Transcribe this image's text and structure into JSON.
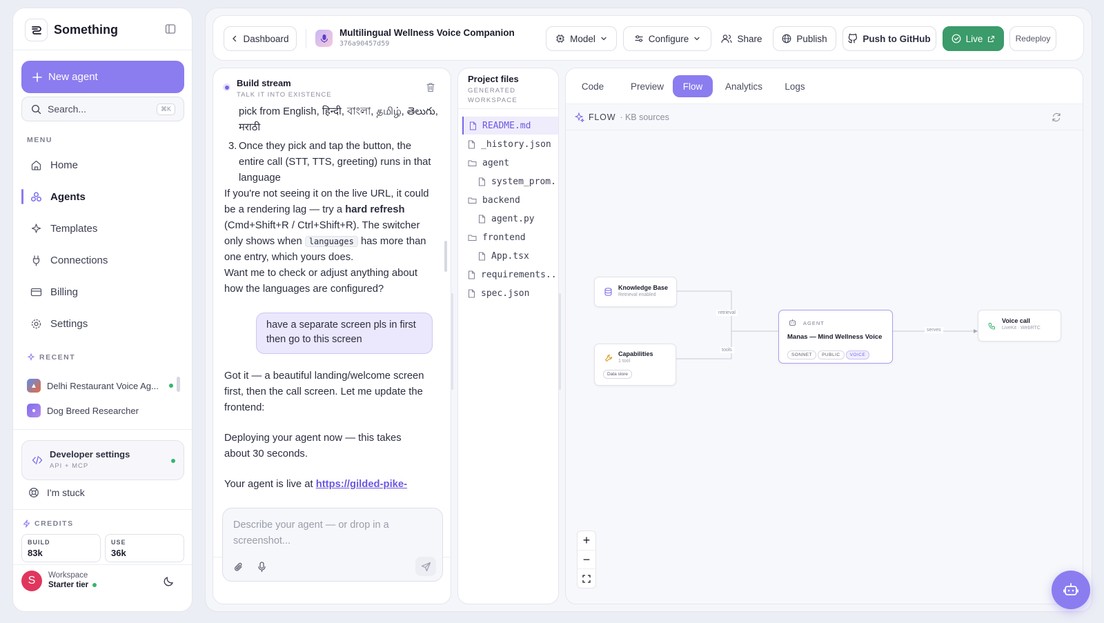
{
  "app": {
    "name": "Something"
  },
  "sidebar": {
    "new_agent": "New agent",
    "search_placeholder": "Search...",
    "search_shortcut": "⌘K",
    "menu_label": "MENU",
    "items": [
      {
        "label": "Home",
        "icon": "home-icon"
      },
      {
        "label": "Agents",
        "icon": "agents-icon",
        "active": true
      },
      {
        "label": "Templates",
        "icon": "sparkle-icon"
      },
      {
        "label": "Connections",
        "icon": "plug-icon"
      },
      {
        "label": "Billing",
        "icon": "card-icon"
      },
      {
        "label": "Settings",
        "icon": "gear-icon"
      }
    ],
    "recent_label": "RECENT",
    "recent": [
      {
        "label": "Delhi Restaurant Voice Ag...",
        "live": true
      },
      {
        "label": "Dog Breed Researcher",
        "live": false
      }
    ],
    "developer": {
      "title": "Developer settings",
      "subtitle": "API + MCP"
    },
    "stuck": "I'm stuck",
    "credits_label": "CREDITS",
    "credits": [
      {
        "label": "BUILD",
        "value": "83k"
      },
      {
        "label": "USE",
        "value": "36k"
      }
    ],
    "workspace": {
      "initial": "S",
      "label": "Workspace",
      "tier": "Starter tier"
    }
  },
  "topbar": {
    "back": "Dashboard",
    "project_title": "Multilingual Wellness Voice Companion",
    "project_id": "376a90457d59",
    "model": "Model",
    "configure": "Configure",
    "share": "Share",
    "publish": "Publish",
    "github": "Push to GitHub",
    "live": "Live",
    "redeploy": "Redeploy",
    "accent": "#3b9b6a"
  },
  "chat": {
    "title": "Build stream",
    "subtitle": "TALK IT INTO EXISTENCE",
    "line_top": "pick from English, हिन्दी, বাংলা, தமிழ், తెలుగు,",
    "line_top2": "मराठी",
    "item3": "Once they pick and tap the button, the entire call (STT, TTS, greeting) runs in that language",
    "p1_a": "If you're not seeing it on the live URL, it could be a rendering lag — try a ",
    "p1_bold": "hard refresh",
    "p1_b": " (Cmd+Shift+R / Ctrl+Shift+R). The switcher only shows when ",
    "p1_code": "languages",
    "p1_c": " has more than one entry, which yours does.",
    "p2": "Want me to check or adjust anything about how the languages are configured?",
    "user_msg": "have a separate screen pls in first then go to this screen",
    "p3": "Got it — a beautiful landing/welcome screen first, then the call screen. Let me update the frontend:",
    "p4": "Deploying your agent now — this takes about 30 seconds.",
    "p5_a": "Your agent is live at ",
    "p5_link": "https://gilded-pike-",
    "input_placeholder": "Describe your agent — or drop in a screenshot..."
  },
  "files": {
    "title": "Project files",
    "subtitle": "GENERATED WORKSPACE",
    "items": [
      {
        "name": "README.md",
        "type": "file",
        "depth": 0,
        "selected": true
      },
      {
        "name": "_history.json",
        "type": "file",
        "depth": 0
      },
      {
        "name": "agent",
        "type": "folder",
        "depth": 0
      },
      {
        "name": "system_prom...",
        "type": "file",
        "depth": 1
      },
      {
        "name": "backend",
        "type": "folder",
        "depth": 0
      },
      {
        "name": "agent.py",
        "type": "file",
        "depth": 1
      },
      {
        "name": "frontend",
        "type": "folder",
        "depth": 0
      },
      {
        "name": "App.tsx",
        "type": "file",
        "depth": 1
      },
      {
        "name": "requirements....",
        "type": "file",
        "depth": 0
      },
      {
        "name": "spec.json",
        "type": "file",
        "depth": 0
      }
    ]
  },
  "workspace": {
    "tabs": [
      "Code",
      "Preview",
      "Flow",
      "Analytics",
      "Logs"
    ],
    "active_tab": "Flow",
    "flow_label": "FLOW",
    "flow_sub": "· KB sources",
    "nodes": {
      "kb": {
        "title": "Knowledge Base",
        "sub": "Retrieval enabled"
      },
      "cap": {
        "title": "Capabilities",
        "sub": "1 tool",
        "chip": "Data store"
      },
      "agent": {
        "kicker": "AGENT",
        "title": "Manas — Mind Wellness Voice",
        "chips": [
          "SONNET",
          "PUBLIC",
          "VOICE"
        ]
      },
      "voice": {
        "title": "Voice call",
        "sub": "LiveKit · WebRTC"
      }
    },
    "edges": [
      "retrieval",
      "tools",
      "serves"
    ],
    "zoom": [
      "+",
      "−"
    ]
  }
}
